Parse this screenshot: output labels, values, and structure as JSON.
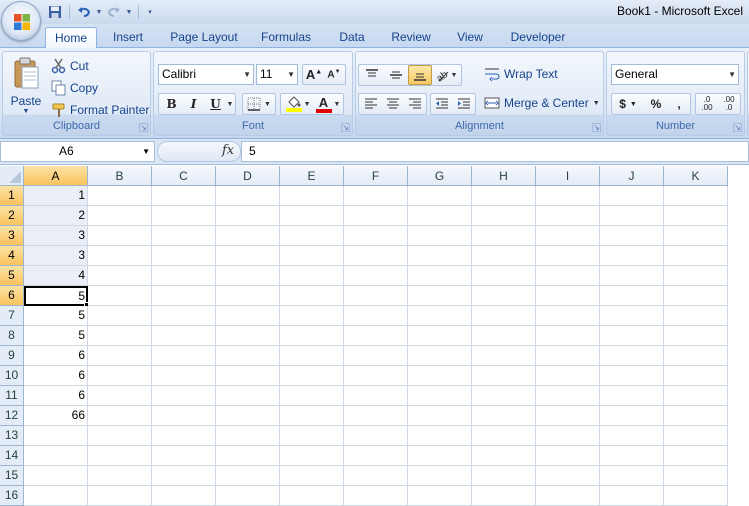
{
  "window": {
    "title": "Book1 - Microsoft Excel"
  },
  "qat": {
    "icons": [
      "save-icon",
      "undo-icon",
      "redo-icon",
      "customize-icon"
    ]
  },
  "tabs": [
    "Home",
    "Insert",
    "Page Layout",
    "Formulas",
    "Data",
    "Review",
    "View",
    "Developer"
  ],
  "active_tab": "Home",
  "ribbon": {
    "clipboard": {
      "label": "Clipboard",
      "paste": "Paste",
      "cut": "Cut",
      "copy": "Copy",
      "format_painter": "Format Painter"
    },
    "font": {
      "label": "Font",
      "name": "Calibri",
      "size": "11",
      "grow": "A",
      "shrink": "A",
      "bold": "B",
      "italic": "I",
      "underline": "U",
      "font_color": "A"
    },
    "alignment": {
      "label": "Alignment",
      "wrap_text": "Wrap Text",
      "merge_center": "Merge & Center"
    },
    "number": {
      "label": "Number",
      "format": "General",
      "currency": "$",
      "percent": "%",
      "comma": ",",
      "inc_dec": ".0\n.00",
      "dec_dec": ".00\n.0"
    }
  },
  "formula_bar": {
    "name_box": "A6",
    "fx": "fx",
    "value": "5"
  },
  "sheet": {
    "columns": [
      "A",
      "B",
      "C",
      "D",
      "E",
      "F",
      "G",
      "H",
      "I",
      "J",
      "K"
    ],
    "rows": [
      "1",
      "2",
      "3",
      "4",
      "5",
      "6",
      "7",
      "8",
      "9",
      "10",
      "11",
      "12",
      "13",
      "14",
      "15",
      "16"
    ],
    "column_a_values": [
      "1",
      "2",
      "3",
      "3",
      "4",
      "5",
      "5",
      "5",
      "6",
      "6",
      "6",
      "66",
      "",
      "",
      "",
      ""
    ],
    "selected_column": "A",
    "selected_rows": [
      "1",
      "2",
      "3",
      "4",
      "5",
      "6"
    ],
    "active_cell": "A6"
  },
  "colors": {
    "ribbon_blue": "#dbe6f4",
    "header_highlight": "#f9c25e",
    "font_red": "#e00000",
    "fill_yellow": "#ffff00"
  }
}
